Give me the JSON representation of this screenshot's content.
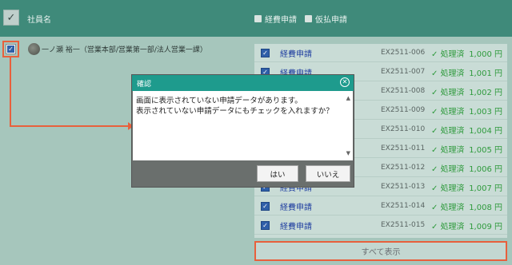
{
  "header": {
    "employee_label": "社員名",
    "legend": [
      "経費申請",
      "仮払申請"
    ]
  },
  "employee": {
    "name": "一ノ瀬 裕一（営業本部/営業第一部/法人営業一課）"
  },
  "requests": [
    {
      "kind": "経費申請",
      "code": "EX2511-006",
      "status": "処理済",
      "amount": "1,000 円"
    },
    {
      "kind": "経費申請",
      "code": "EX2511-007",
      "status": "処理済",
      "amount": "1,001 円"
    },
    {
      "kind": "経費申請",
      "code": "EX2511-008",
      "status": "処理済",
      "amount": "1,002 円"
    },
    {
      "kind": "経費申請",
      "code": "EX2511-009",
      "status": "処理済",
      "amount": "1,003 円"
    },
    {
      "kind": "経費申請",
      "code": "EX2511-010",
      "status": "処理済",
      "amount": "1,004 円"
    },
    {
      "kind": "経費申請",
      "code": "EX2511-011",
      "status": "処理済",
      "amount": "1,005 円"
    },
    {
      "kind": "経費申請",
      "code": "EX2511-012",
      "status": "処理済",
      "amount": "1,006 円"
    },
    {
      "kind": "経費申請",
      "code": "EX2511-013",
      "status": "処理済",
      "amount": "1,007 円"
    },
    {
      "kind": "経費申請",
      "code": "EX2511-014",
      "status": "処理済",
      "amount": "1,008 円"
    },
    {
      "kind": "経費申請",
      "code": "EX2511-015",
      "status": "処理済",
      "amount": "1,009 円"
    }
  ],
  "show_all_label": "すべて表示",
  "dialog": {
    "title": "確認",
    "line1": "画面に表示されていない申請データがあります。",
    "line2": "表示されていない申請データにもチェックを入れますか？",
    "yes_label": "はい",
    "no_label": "いいえ"
  },
  "colors": {
    "header": "#3f8a7a",
    "accent_highlight": "#e8603c",
    "dialog_title": "#1e9b8d",
    "status_green": "#2e9a3c"
  }
}
